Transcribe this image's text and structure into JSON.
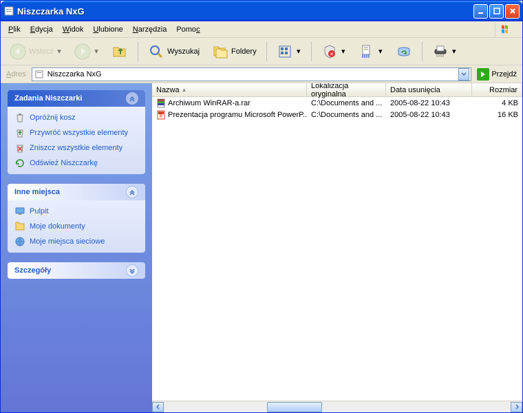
{
  "window": {
    "title": "Niszczarka NxG"
  },
  "menu": {
    "file": "Plik",
    "file_u": "P",
    "edit": "Edycja",
    "edit_u": "E",
    "view": "Widok",
    "view_u": "W",
    "favorites": "Ulubione",
    "favorites_u": "U",
    "tools": "Narzędzia",
    "tools_u": "N",
    "help": "Pomoc",
    "help_u": "c"
  },
  "toolbar": {
    "back": "Wstecz",
    "search": "Wyszukaj",
    "folders": "Foldery"
  },
  "address": {
    "label": "Adres",
    "value": "Niszczarka NxG",
    "go": "Przejdź"
  },
  "sidebar": {
    "tasks": {
      "title": "Zadania Niszczarki",
      "items": [
        {
          "label": "Opróżnij kosz",
          "icon": "empty-bin-icon"
        },
        {
          "label": "Przywróć wszystkie elementy",
          "icon": "restore-all-icon"
        },
        {
          "label": "Zniszcz wszystkie elementy",
          "icon": "shred-all-icon"
        },
        {
          "label": "Odśwież Niszczarkę",
          "icon": "refresh-icon"
        }
      ]
    },
    "places": {
      "title": "Inne miejsca",
      "items": [
        {
          "label": "Pulpit",
          "icon": "desktop-icon"
        },
        {
          "label": "Moje dokumenty",
          "icon": "documents-icon"
        },
        {
          "label": "Moje miejsca sieciowe",
          "icon": "network-icon"
        }
      ]
    },
    "details": {
      "title": "Szczegóły"
    }
  },
  "columns": {
    "name": "Nazwa",
    "location": "Lokalizacja oryginalna",
    "date": "Data usunięcia",
    "size": "Rozmiar"
  },
  "rows": [
    {
      "name": "Archiwum WinRAR-a.rar",
      "location": "C:\\Documents and ...",
      "date": "2005-08-22 10:43",
      "size": "4 KB",
      "icon": "rar"
    },
    {
      "name": "Prezentacja programu Microsoft PowerP...",
      "location": "C:\\Documents and ...",
      "date": "2005-08-22 10:43",
      "size": "16 KB",
      "icon": "ppt"
    }
  ]
}
